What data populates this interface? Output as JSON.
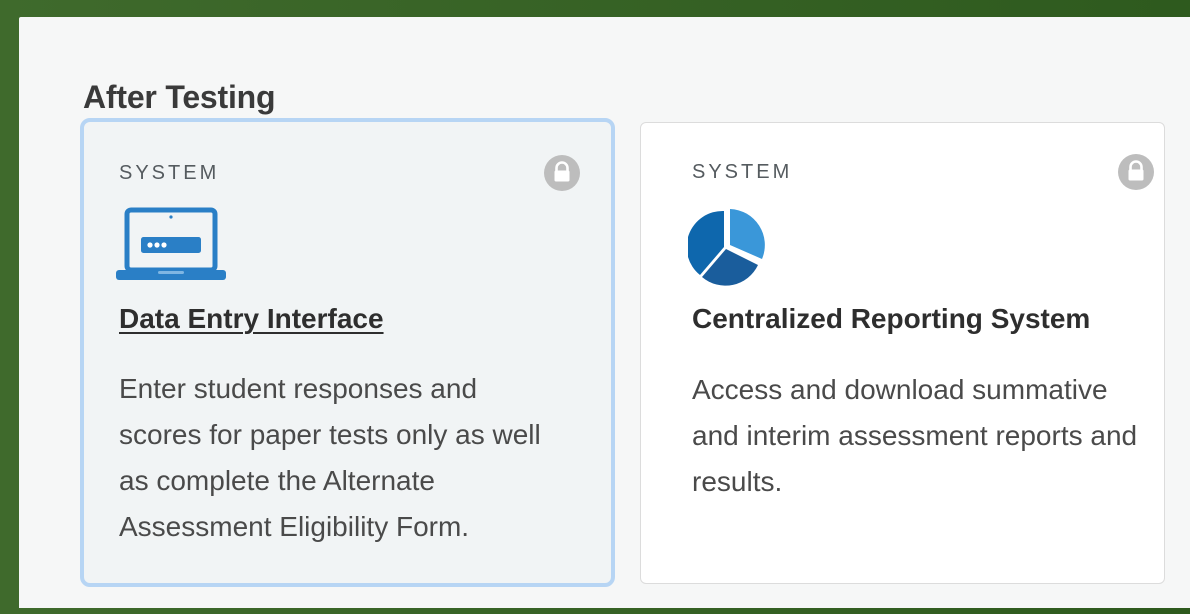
{
  "section": {
    "title": "After Testing"
  },
  "cards": [
    {
      "eyebrow": "SYSTEM",
      "title": "Data Entry Interface",
      "description": "Enter student responses and scores for paper tests only as well as complete the Alternate Assessment Eligibility Form.",
      "icon": "laptop-icon",
      "locked": true,
      "selected": true
    },
    {
      "eyebrow": "SYSTEM",
      "title": "Centralized Reporting System",
      "description": "Access and download summative and interim assessment reports and results.",
      "icon": "pie-chart-icon",
      "locked": true,
      "selected": false
    }
  ],
  "colors": {
    "frame": "#2f5a1f",
    "panel": "#f6f7f7",
    "selected_border": "#b7d5f4",
    "icon_blue": "#2a7fc6",
    "lock_gray": "#bdbdbd"
  }
}
